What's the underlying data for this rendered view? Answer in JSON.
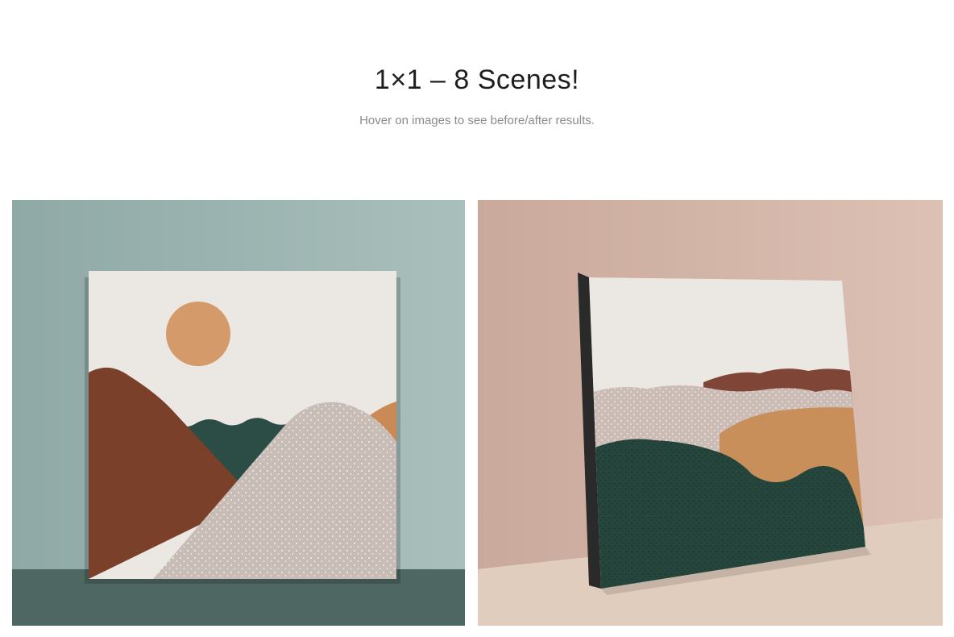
{
  "header": {
    "title": "1×1 – 8 Scenes!",
    "subtitle": "Hover on images to see before/after results."
  },
  "previews": [
    {
      "name": "scene-1",
      "background": "#9db5b2",
      "floor": "#4f6762",
      "canvas_colors": [
        "#ebe8e3",
        "#d49a6a",
        "#7a4029",
        "#2c4d46",
        "#c8bcb6"
      ]
    },
    {
      "name": "scene-2",
      "background": "#d3b6a9",
      "floor": "#e1cdbd",
      "canvas_colors": [
        "#ebe8e3",
        "#7f4537",
        "#cbbcb5",
        "#c98f5b",
        "#26463d"
      ]
    }
  ]
}
